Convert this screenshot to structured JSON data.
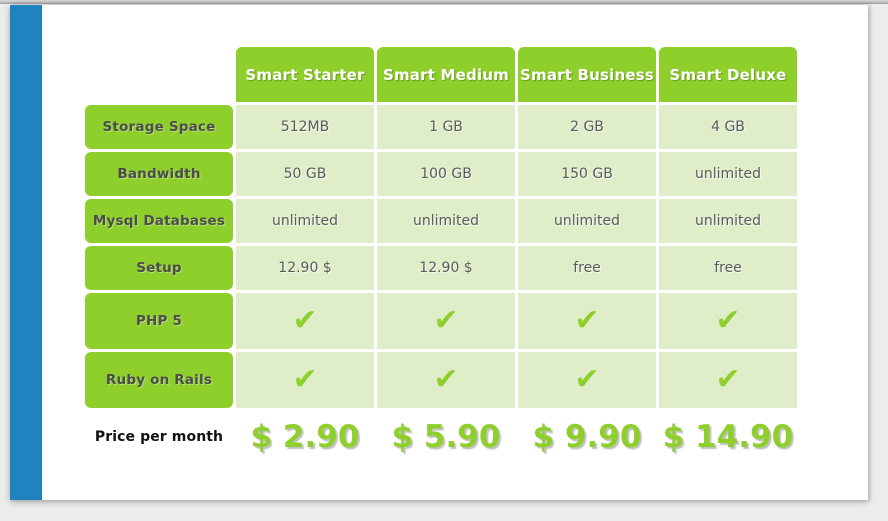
{
  "page": {
    "accent_blue": "#1f84bd",
    "brand_green": "#8ecf2c",
    "cell_green": "#dfeec9",
    "page_background": "#ffffff",
    "desktop_background": "#ececec"
  },
  "table": {
    "corner_label": "",
    "plans": [
      {
        "name": "Smart Starter"
      },
      {
        "name": "Smart Medium"
      },
      {
        "name": "Smart Business"
      },
      {
        "name": "Smart Deluxe"
      }
    ],
    "rows": [
      {
        "label": "Storage Space",
        "tall": false,
        "values": [
          "512MB",
          "1 GB",
          "2 GB",
          "4 GB"
        ]
      },
      {
        "label": "Bandwidth",
        "tall": false,
        "values": [
          "50 GB",
          "100 GB",
          "150 GB",
          "unlimited"
        ]
      },
      {
        "label": "Mysql Databases",
        "tall": false,
        "values": [
          "unlimited",
          "unlimited",
          "unlimited",
          "unlimited"
        ]
      },
      {
        "label": "Setup",
        "tall": false,
        "values": [
          "12.90 $",
          "12.90 $",
          "free",
          "free"
        ]
      },
      {
        "label": "PHP 5",
        "tall": true,
        "values": [
          "check-icon",
          "check-icon",
          "check-icon",
          "check-icon"
        ]
      },
      {
        "label": "Ruby on Rails",
        "tall": true,
        "values": [
          "check-icon",
          "check-icon",
          "check-icon",
          "check-icon"
        ]
      }
    ],
    "price_row": {
      "label": "Price per month",
      "values": [
        "$ 2.90",
        "$ 5.90",
        "$ 9.90",
        "$ 14.90"
      ]
    },
    "check_glyph": "✔"
  }
}
